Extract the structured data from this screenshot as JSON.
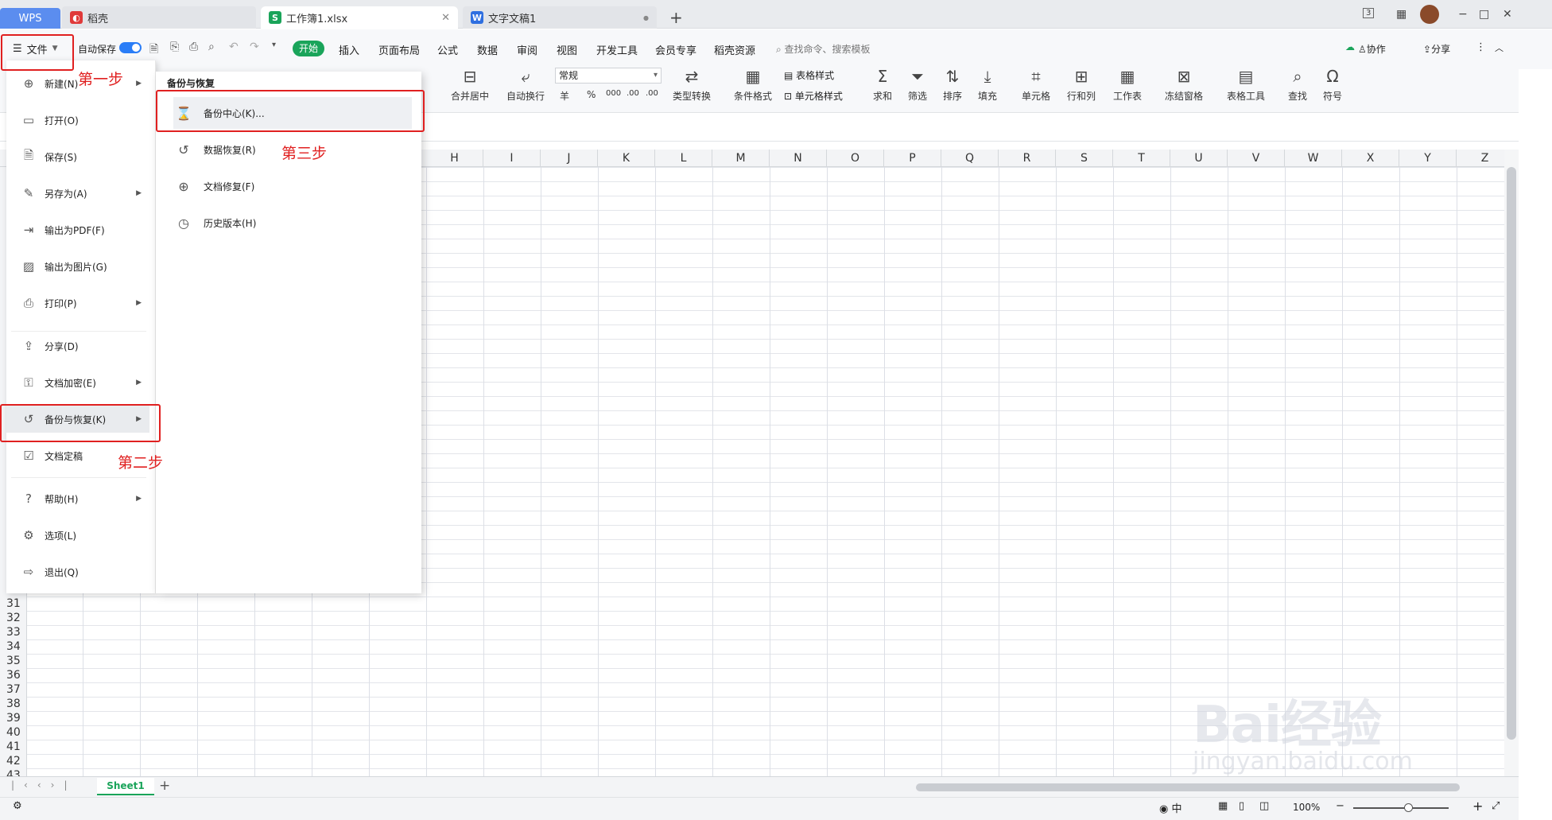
{
  "tabs": {
    "wps": "WPS",
    "daoke": "稻壳",
    "book": "工作簿1.xlsx",
    "doc": "文字文稿1",
    "add": "+"
  },
  "window": {
    "badge": "3",
    "min": "−",
    "max": "□",
    "close": "✕"
  },
  "quickbar": {
    "file": "文件",
    "autosave": "自动保存",
    "menus": [
      "开始",
      "插入",
      "页面布局",
      "公式",
      "数据",
      "审阅",
      "视图",
      "开发工具",
      "会员专享",
      "稻壳资源"
    ],
    "search": "查找命令、搜索模板",
    "collab": "协作",
    "share": "分享"
  },
  "ribbon": {
    "merge": "合并居中",
    "wrap": "自动换行",
    "numfmt": "常规",
    "yen": "羊",
    "pct": "%",
    "n000": "000",
    "dec1": ".00",
    "dec2": ".00",
    "convert": "类型转换",
    "cond": "条件格式",
    "tablestyle": "表格样式",
    "cellstyle": "单元格样式",
    "sum": "求和",
    "filter": "筛选",
    "sort": "排序",
    "fill": "填充",
    "cell": "单元格",
    "rowcol": "行和列",
    "sheet": "工作表",
    "freeze": "冻结窗格",
    "tools": "表格工具",
    "find": "查找",
    "symbol": "符号"
  },
  "columns": [
    "H",
    "I",
    "J",
    "K",
    "L",
    "M",
    "N",
    "O",
    "P",
    "Q",
    "R",
    "S",
    "T",
    "U",
    "V",
    "W",
    "X",
    "Y",
    "Z"
  ],
  "rows": [
    "31",
    "32",
    "33",
    "34",
    "35",
    "36",
    "37",
    "38",
    "39",
    "40",
    "41",
    "42",
    "43"
  ],
  "sheet": {
    "tab": "Sheet1",
    "add": "+"
  },
  "status": {
    "zoom": "100%"
  },
  "filemenu": [
    {
      "label": "新建(N)",
      "icon": "new-icon",
      "arrow": true
    },
    {
      "label": "打开(O)",
      "icon": "open-icon",
      "arrow": false
    },
    {
      "label": "保存(S)",
      "icon": "save-icon",
      "arrow": false
    },
    {
      "label": "另存为(A)",
      "icon": "save-as-icon",
      "arrow": true
    },
    {
      "label": "输出为PDF(F)",
      "icon": "pdf-icon",
      "arrow": false
    },
    {
      "label": "输出为图片(G)",
      "icon": "image-icon",
      "arrow": false
    },
    {
      "label": "打印(P)",
      "icon": "print-icon",
      "arrow": true
    },
    {
      "label": "分享(D)",
      "icon": "share-icon",
      "arrow": false
    },
    {
      "label": "文档加密(E)",
      "icon": "lock-icon",
      "arrow": true
    },
    {
      "label": "备份与恢复(K)",
      "icon": "backup-icon",
      "arrow": true
    },
    {
      "label": "文档定稿",
      "icon": "finalize-icon",
      "arrow": false
    },
    {
      "label": "帮助(H)",
      "icon": "help-icon",
      "arrow": true
    },
    {
      "label": "选项(L)",
      "icon": "gear-icon",
      "arrow": false
    },
    {
      "label": "退出(Q)",
      "icon": "exit-icon",
      "arrow": false
    }
  ],
  "submenu": {
    "title": "备份与恢复",
    "items": [
      "备份中心(K)...",
      "数据恢复(R)",
      "文档修复(F)",
      "历史版本(H)"
    ]
  },
  "notes": {
    "step1": "第一步",
    "step2": "第二步",
    "step3": "第三步"
  },
  "watermark": {
    "main": "Bai经验",
    "sub": "jingyan.baidu.com"
  },
  "colors": {
    "accent": "#1aa45a",
    "annotation": "#e02020",
    "wps": "#5b8def"
  }
}
